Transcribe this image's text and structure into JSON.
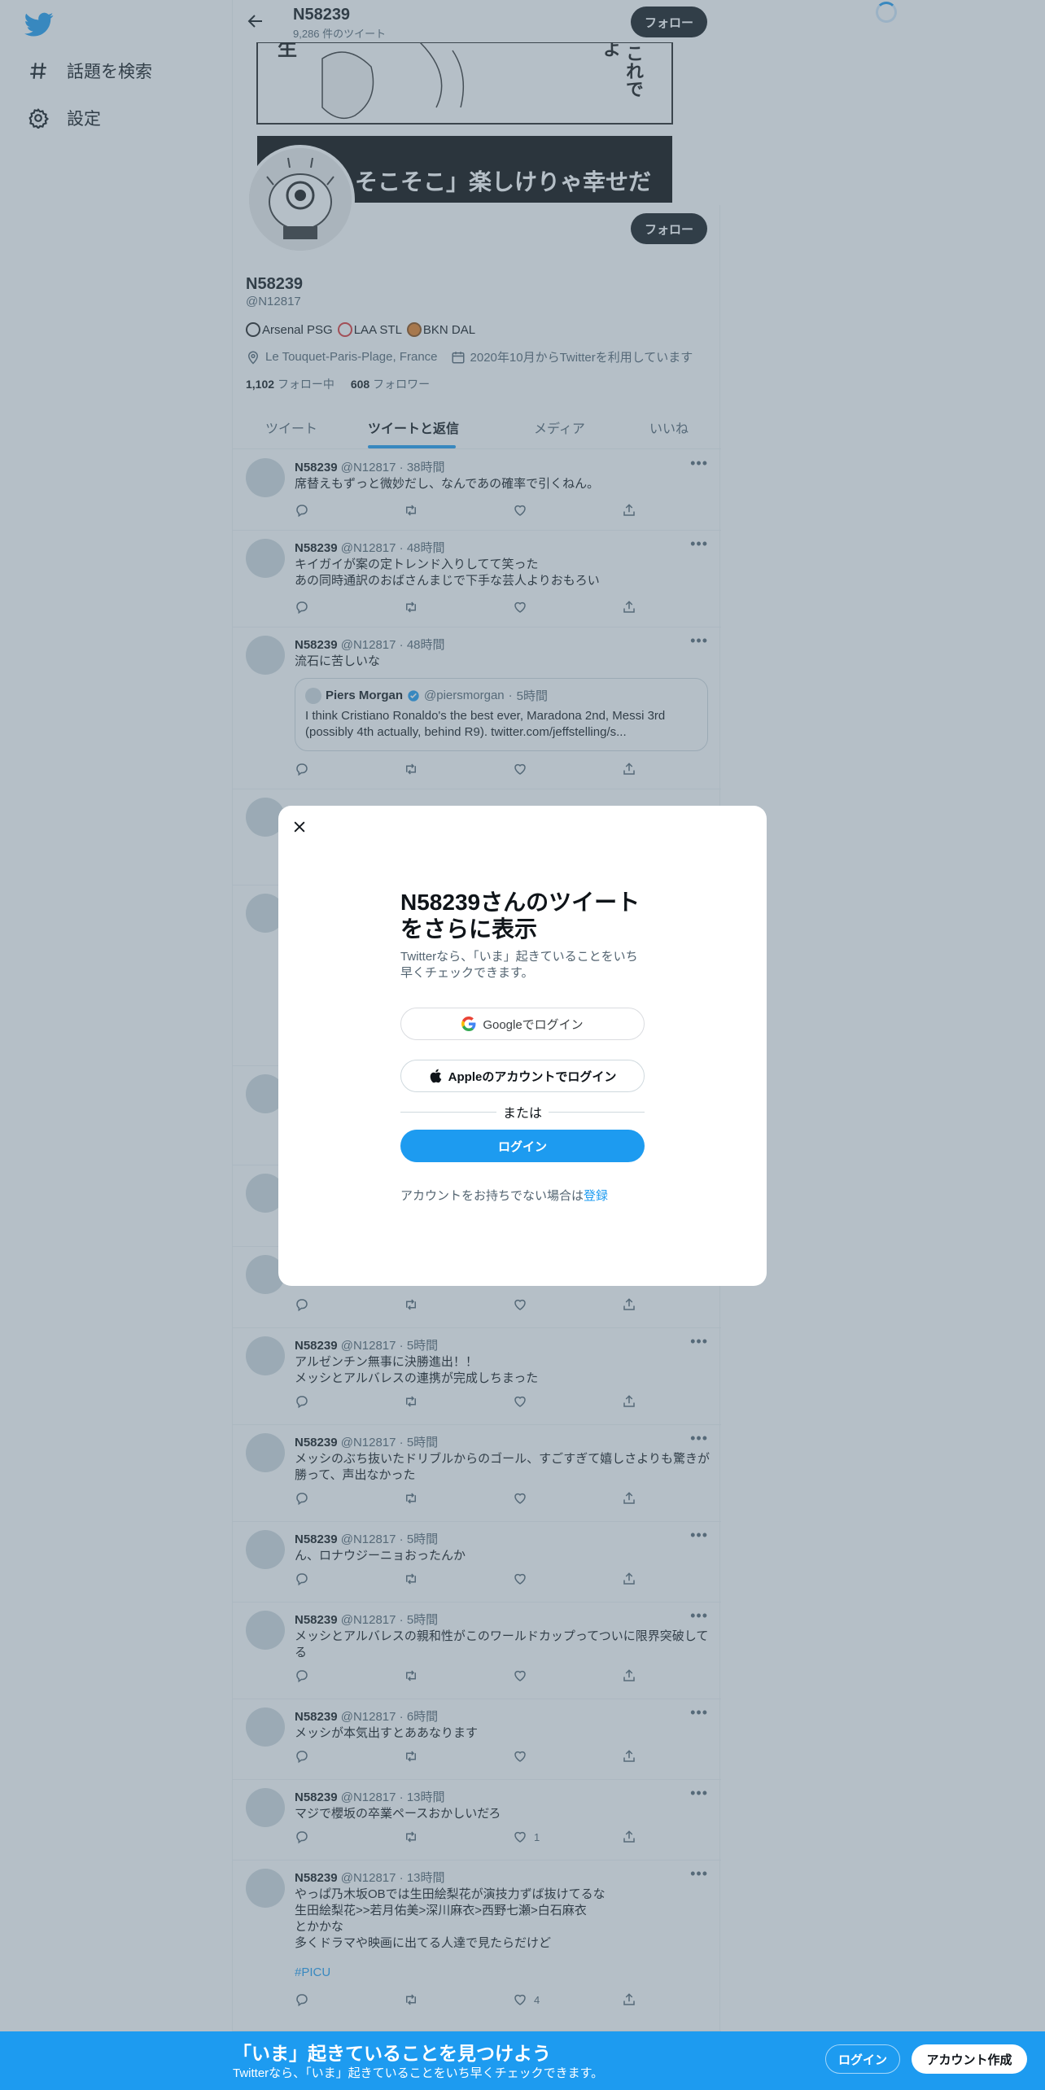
{
  "nav": {
    "explore_label": "話題を検索",
    "settings_label": "設定"
  },
  "header": {
    "name": "N58239",
    "tweet_count": "9,286 件のツイート",
    "follow_label": "フォロー"
  },
  "banner": {
    "top_text": "これで",
    "caption": "そこそこ」楽しけりゃ幸せだ"
  },
  "profile": {
    "name": "N58239",
    "handle": "@N12817",
    "bio": [
      "Arsenal PSG",
      "LAA STL",
      "BKN DAL"
    ],
    "location": "Le Touquet-Paris-Plage, France",
    "joined": "2020年10月からTwitterを利用しています",
    "following_count": "1,102",
    "following_label": "フォロー中",
    "followers_count": "608",
    "followers_label": "フォロワー",
    "follow_label": "フォロー"
  },
  "tabs": [
    "ツイート",
    "ツイートと返信",
    "メディア",
    "いいね"
  ],
  "tweets": [
    {
      "name": "N58239",
      "handle": "@N12817",
      "time": "38時間",
      "text": "席替えもずっと微妙だし、なんであの確率で引くねん。"
    },
    {
      "name": "N58239",
      "handle": "@N12817",
      "time": "48時間",
      "text": "キイガイが案の定トレンド入りしてて笑った\nあの同時通訳のおばさんまじで下手な芸人よりおもろい"
    },
    {
      "name": "N58239",
      "handle": "@N12817",
      "time": "48時間",
      "text": "流石に苦しいな",
      "quote": {
        "name": "Piers Morgan",
        "handle": "@piersmorgan",
        "time": "5時間",
        "text": "I think Cristiano Ronaldo's the best ever, Maradona 2nd, Messi 3rd (possibly 4th actually, behind R9). twitter.com/jeffstelling/s..."
      }
    },
    {
      "name": "N58239",
      "handle": "@N12817",
      "time": "5時間",
      "text": "アルゼンチン無事に決勝進出！！\nメッシとアルバレスの連携が完成しちまった"
    },
    {
      "name": "N58239",
      "handle": "@N12817",
      "time": "5時間",
      "text": "メッシのぶち抜いたドリブルからのゴール、すごすぎて嬉しさよりも驚きが勝って、声出なかった"
    },
    {
      "name": "N58239",
      "handle": "@N12817",
      "time": "5時間",
      "text": "ん、ロナウジーニョおったんか"
    },
    {
      "name": "N58239",
      "handle": "@N12817",
      "time": "5時間",
      "text": "メッシとアルバレスの親和性がこのワールドカップってついに限界突破してる"
    },
    {
      "name": "N58239",
      "handle": "@N12817",
      "time": "6時間",
      "text": "メッシが本気出すとああなります"
    },
    {
      "name": "N58239",
      "handle": "@N12817",
      "time": "13時間",
      "text": "マジで櫻坂の卒業ペースおかしいだろ",
      "likes": "1"
    },
    {
      "name": "N58239",
      "handle": "@N12817",
      "time": "13時間",
      "text": "やっぱ乃木坂OBでは生田絵梨花が演技力ずば抜けてるな\n生田絵梨花>>若月佑美>深川麻衣>西野七瀬>白石麻衣\nとかかな\n多くドラマや映画に出てる人達で見たらだけど",
      "hashtag": "#PICU",
      "likes": "4"
    }
  ],
  "modal": {
    "title": "N58239さんのツイートをさらに表示",
    "subtitle": "Twitterなら、「いま」起きていることをいち早くチェックできます。",
    "google_label": "Googleでログイン",
    "apple_label": "Appleのアカウントでログイン",
    "or_label": "または",
    "login_label": "ログイン",
    "signup_prompt": "アカウントをお持ちでない場合は",
    "signup_link": "登録"
  },
  "bottom_bar": {
    "title": "「いま」起きていることを見つけよう",
    "subtitle": "Twitterなら、「いま」起きていることをいち早くチェックできます。",
    "login_label": "ログイン",
    "signup_label": "アカウント作成"
  },
  "colors": {
    "brand": "#1d9bf0",
    "text": "#0f1419",
    "secondary": "#536471"
  }
}
